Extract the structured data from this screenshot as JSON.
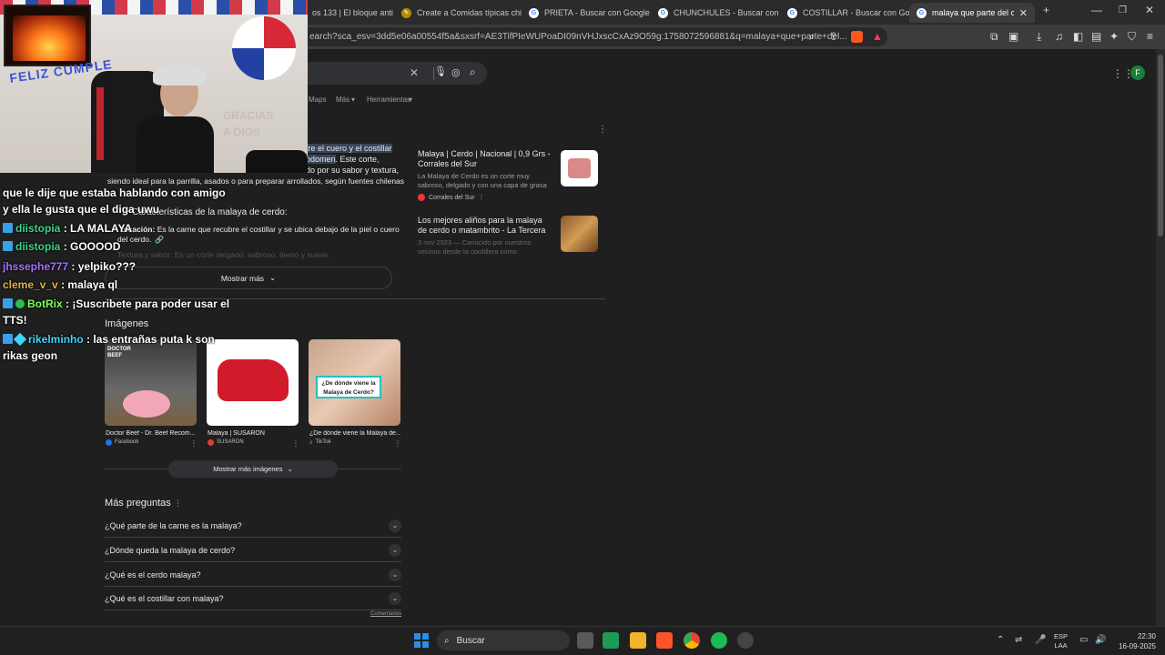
{
  "tabs": [
    {
      "label": "os 133 | El bloque anti"
    },
    {
      "label": "Create a Comidas típicas chile"
    },
    {
      "label": "PRIETA - Buscar con Google"
    },
    {
      "label": "CHUNCHULES - Buscar con Go"
    },
    {
      "label": "COSTILLAR - Buscar con Goog"
    },
    {
      "label": "malaya que parte del cerdo"
    }
  ],
  "address": "earch?sca_esv=3dd5e06a00554f5a&sxsrf=AE3TifPIeWUPoaDI09nVHJxscCxAz9O59g:1758072596881&q=malaya+que+parte+del...",
  "nav": {
    "maps": "Maps",
    "more": "Más",
    "tools": "Herramientas"
  },
  "account_initial": "F",
  "snippet": {
    "highlight1": "tre el cuero y el costillar",
    "highlight2": "odomen",
    "rest1": ". Este corte,",
    "rest2": "do por su sabor y textura,",
    "line3": "siendo ideal para la parrilla, asados o para preparar arrollados, según fuentes chilenas",
    "heading": "Características de la malaya de cerdo:",
    "bullet_label": "bicación:",
    "bullet_text": "Es la carne que recubre el costillar y se ubica debajo de la piel o cuero",
    "bullet_text2": "del cerdo.",
    "faded": "Textura y sabor: Es un corte delgado, sabroso, tierno y suave.",
    "show_more": "Mostrar más"
  },
  "cards": [
    {
      "title": "Malaya | Cerdo | Nacional | 0,9 Grs - Corrales del Sur",
      "desc": "La Malaya de Cerdo es un corte muy sabroso, delgado y con una capa de grasa que lo hace...",
      "source": "Corrales del Sur"
    },
    {
      "title": "Los mejores aliños para la malaya de cerdo o matambrito - La Tercera",
      "desc": "3 nov 2023 — Conocido por nuestros vecinos desde la cordillera como matambrito, es un..."
    }
  ],
  "images": {
    "heading": "Imágenes",
    "items": [
      {
        "caption": "Doctor Beef - Dr. Beef Recom...",
        "source": "Facebook",
        "overlay": "DOCTOR BEEF"
      },
      {
        "caption": "Malaya | SUSARON",
        "source": "SUSARON"
      },
      {
        "caption": "¿De dónde viene la Malaya de...",
        "source": "TikTok",
        "overlay": "¿De dónde viene la Malaya de Cerdo?"
      }
    ],
    "show_more": "Mostrar más imágenes"
  },
  "questions": {
    "heading": "Más preguntas",
    "items": [
      "¿Qué parte de la carne es la malaya?",
      "¿Dónde queda la malaya de cerdo?",
      "¿Qué es el cerdo malaya?",
      "¿Qué es el costillar con malaya?"
    ],
    "feedback": "Comentarios"
  },
  "chat": [
    {
      "user": "",
      "text": "que le dije que estaba hablando con amigo",
      "color": "#ffffff"
    },
    {
      "user": "",
      "text": "y ella le gusta que el diga uwu",
      "color": "#ffffff"
    },
    {
      "user": "diistopia",
      "text": ": LA MALAYA",
      "color": "#3ad48a"
    },
    {
      "user": "diistopia",
      "text": ": GOOOOD",
      "color": "#3ad48a"
    },
    {
      "user": "jhssephe777",
      "text": ": yelpiko???",
      "color": "#a970ff"
    },
    {
      "user": "cleme_v_v",
      "text": ": malaya ql",
      "color": "#e0b04a"
    },
    {
      "user": "BotRix",
      "text": ": ¡Suscribete para poder usar el",
      "color": "#7cff5a"
    },
    {
      "user": "",
      "text": "TTS!",
      "color": "#ffffff"
    },
    {
      "user": "rikelminho",
      "text": ": las entrañas puta k son",
      "color": "#43d3ff"
    },
    {
      "user": "",
      "text": "rikas geon",
      "color": "#ffffff"
    }
  ],
  "webcam": {
    "banner": "FELIZ CUMPLE",
    "wall1": "GRACIAS",
    "wall2": "A DIOS"
  },
  "taskbar": {
    "search": "Buscar",
    "lang1": "ESP",
    "lang2": "LAA",
    "time": "22:30",
    "date": "16-09-2025"
  },
  "colors": {
    "accent": "#8ab4f8",
    "highlight": "#394457",
    "account": "#188038"
  }
}
